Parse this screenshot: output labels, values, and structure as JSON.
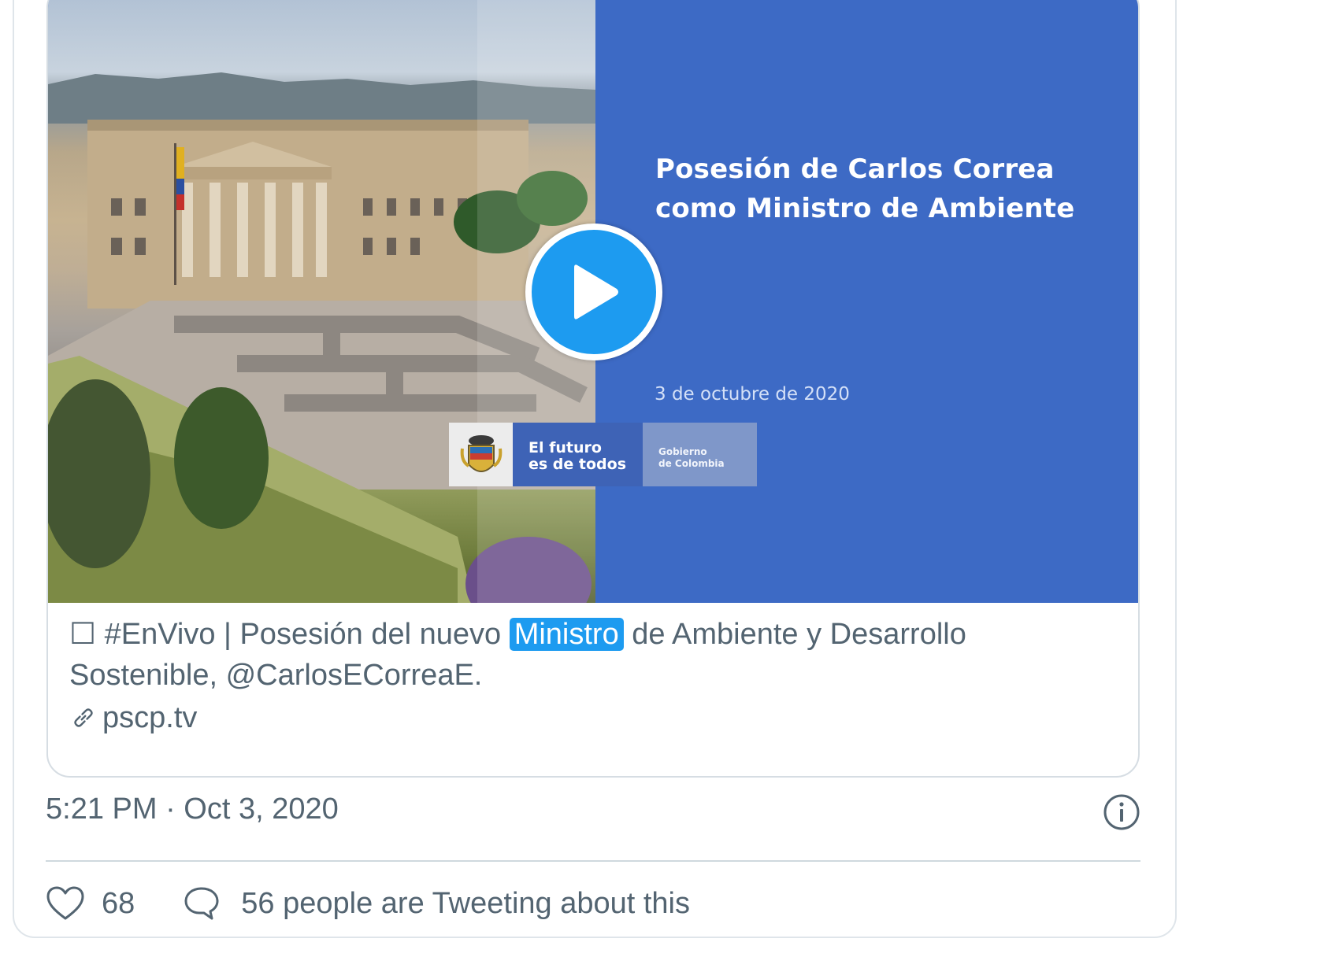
{
  "media": {
    "slide_title_line1": "Posesión de Carlos Correa",
    "slide_title_line2": "como Ministro de Ambiente",
    "slide_date": "3 de octubre de 2020",
    "brand_motto_line1": "El futuro",
    "brand_motto_line2": "es de todos",
    "brand_gov_line1": "Gobierno",
    "brand_gov_line2": "de Colombia",
    "play_icon": "play-icon",
    "colors": {
      "slide_background": "#3d6ac5",
      "play_button": "#1d9bf0"
    }
  },
  "card": {
    "text_before": "☐ #EnVivo | Posesión del nuevo ",
    "highlighted_word": "Ministro",
    "text_after": " de Ambiente y Desarrollo Sostenible, @CarlosECorreaE.",
    "link_icon": "link-icon",
    "link_domain": "pscp.tv"
  },
  "tweet": {
    "timestamp": "5:21 PM · Oct 3, 2020",
    "info_icon": "info-icon",
    "like_icon": "heart-icon",
    "like_count": "68",
    "reply_icon": "speech-bubble-icon",
    "tweeting_text": "56 people are Tweeting about this",
    "colors": {
      "highlight": "#1d9bf0",
      "secondary_text": "#536471"
    }
  }
}
